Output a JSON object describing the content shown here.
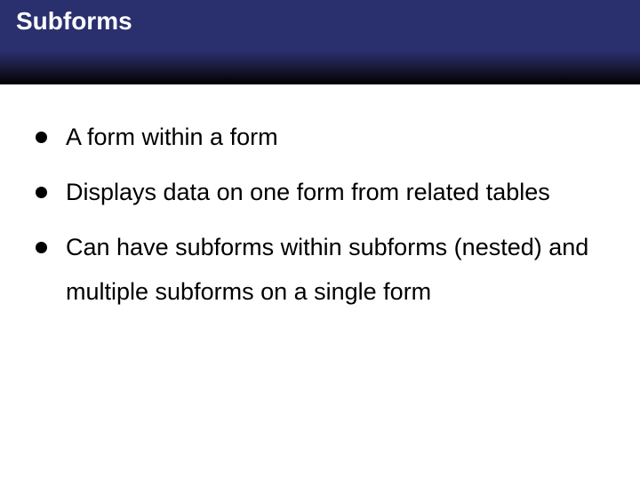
{
  "header": {
    "title": "Subforms"
  },
  "bullets": [
    "A form within a form",
    "Displays data on one form from related tables",
    "Can have subforms within subforms (nested) and multiple subforms on a single form"
  ]
}
